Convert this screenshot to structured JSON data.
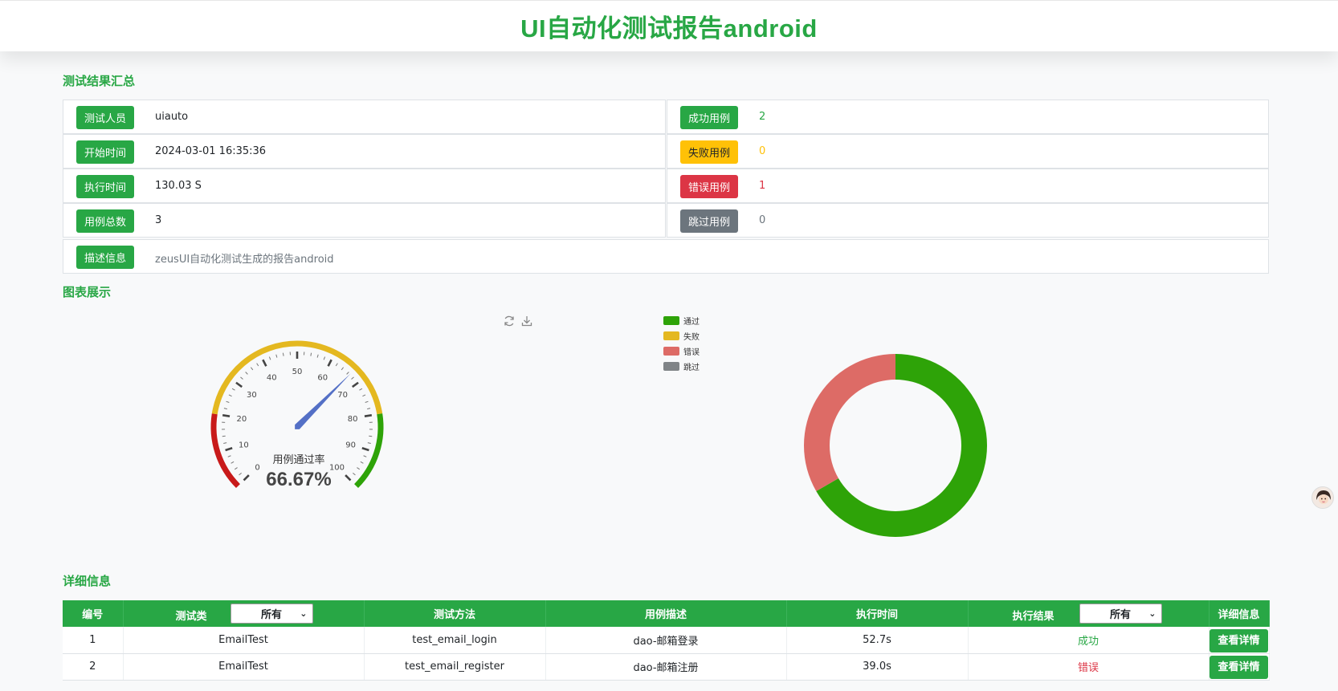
{
  "header": {
    "title": "UI自动化测试报告android"
  },
  "sections": {
    "summary": "测试结果汇总",
    "charts": "图表展示",
    "details": "详细信息"
  },
  "summary": {
    "tester": {
      "label": "测试人员",
      "value": "uiauto"
    },
    "start_time": {
      "label": "开始时间",
      "value": "2024-03-01 16:35:36"
    },
    "duration": {
      "label": "执行时间",
      "value": "130.03 S"
    },
    "total": {
      "label": "用例总数",
      "value": "3"
    },
    "success": {
      "label": "成功用例",
      "value": "2"
    },
    "failed": {
      "label": "失败用例",
      "value": "0"
    },
    "error": {
      "label": "错误用例",
      "value": "1"
    },
    "skipped": {
      "label": "跳过用例",
      "value": "0"
    },
    "description": {
      "label": "描述信息",
      "value": "zeusUI自动化测试生成的报告android"
    }
  },
  "icons": {
    "restore": "refresh-icon",
    "save": "download-icon",
    "assistant": "avatar-icon"
  },
  "colors": {
    "accent": "#28a745",
    "pass": "#2ea308",
    "fail": "#e4b820",
    "error": "#dd6b66",
    "skip": "#808487",
    "gauge_red": "#c81a1a",
    "needle": "#5470c6"
  },
  "chart_data": [
    {
      "type": "gauge",
      "title": "用例通过率",
      "value": 66.67,
      "value_label": "66.67%",
      "range": [
        0,
        100
      ],
      "tick_labels": [
        "0",
        "10",
        "20",
        "30",
        "40",
        "50",
        "60",
        "70",
        "80",
        "90",
        "100"
      ],
      "bands": [
        {
          "to": 20,
          "color": "#c81a1a"
        },
        {
          "to": 80,
          "color": "#e4b820"
        },
        {
          "to": 100,
          "color": "#2ea308"
        }
      ]
    },
    {
      "type": "pie",
      "legend": [
        "通过",
        "失败",
        "错误",
        "跳过"
      ],
      "legend_position": "top-left",
      "slices": [
        {
          "name": "通过",
          "value": 2,
          "color": "#2ea308"
        },
        {
          "name": "失败",
          "value": 0,
          "color": "#e4b820"
        },
        {
          "name": "错误",
          "value": 1,
          "color": "#dd6b66"
        },
        {
          "name": "跳过",
          "value": 0,
          "color": "#808487"
        }
      ]
    }
  ],
  "table": {
    "headers": [
      "编号",
      "测试类",
      "测试方法",
      "用例描述",
      "执行时间",
      "执行结果",
      "详细信息"
    ],
    "class_filter": "所有",
    "result_filter": "所有",
    "detail_button": "查看详情",
    "rows": [
      {
        "id": "1",
        "class": "EmailTest",
        "method": "test_email_login",
        "desc": "dao-邮箱登录",
        "time": "52.7s",
        "result": "成功",
        "status": "pass"
      },
      {
        "id": "2",
        "class": "EmailTest",
        "method": "test_email_register",
        "desc": "dao-邮箱注册",
        "time": "39.0s",
        "result": "错误",
        "status": "error"
      }
    ]
  }
}
